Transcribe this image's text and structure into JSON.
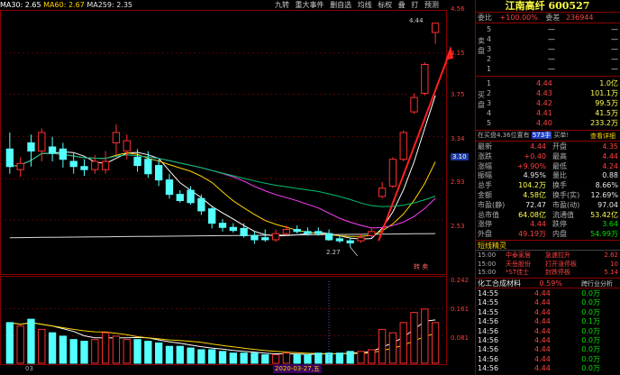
{
  "indicators": {
    "ma30": "MA30: 2.65",
    "ma60": "MA60: 2.67",
    "ma259": "MA259: 2.35"
  },
  "toolbar": [
    "九转",
    "重大事件",
    "删自选",
    "均线",
    "标权",
    "叠",
    "打",
    "预测"
  ],
  "price_scale": [
    "4.56",
    "4.15",
    "3.75",
    "3.34",
    "3.10",
    "2.93",
    "2.53"
  ],
  "vol_scale": [
    "0.242",
    "0.161",
    "0.081"
  ],
  "annotations": {
    "high_label": "4.44",
    "low_label": "2.27",
    "buy_sell": "转 卖",
    "date_axis": "2020-03-27,五",
    "date_left": "03"
  },
  "stock": {
    "name": "江南高纤",
    "code": "600527"
  },
  "order_ratio": {
    "label1": "委比",
    "val1": "+100.00%",
    "label2": "委差",
    "val2": "236944"
  },
  "sell_orders": [
    {
      "label": "5",
      "price": "—",
      "vol": "—"
    },
    {
      "label": "4",
      "price": "—",
      "vol": "—"
    },
    {
      "label": "3",
      "price": "—",
      "vol": "—"
    },
    {
      "label": "2",
      "price": "—",
      "vol": "—"
    },
    {
      "label": "1",
      "price": "—",
      "vol": "—"
    }
  ],
  "buy_orders": [
    {
      "label": "1",
      "price": "4.44",
      "vol": "1.0亿"
    },
    {
      "label": "2",
      "price": "4.43",
      "vol": "101.1万"
    },
    {
      "label": "3",
      "price": "4.42",
      "vol": "99.5万"
    },
    {
      "label": "4",
      "price": "4.41",
      "vol": "41.5万"
    },
    {
      "label": "5",
      "price": "4.40",
      "vol": "233.2万"
    }
  ],
  "side_labels": {
    "sell": "卖盘",
    "buy": "买盘"
  },
  "queue_bar": {
    "left": "在买盘4.36位置有",
    "mid": "573手",
    "right": "买单!",
    "link": "查看详细"
  },
  "quote": [
    {
      "k1": "最新",
      "v1": "4.44",
      "k2": "开盘",
      "v2": "4.35"
    },
    {
      "k1": "涨跌",
      "v1": "+0.40",
      "k2": "最高",
      "v2": "4.44"
    },
    {
      "k1": "涨幅",
      "v1": "+9.90%",
      "k2": "最低",
      "v2": "4.24"
    },
    {
      "k1": "振幅",
      "v1": "4.95%",
      "k2": "量比",
      "v2": "0.88"
    },
    {
      "k1": "总手",
      "v1": "104.2万",
      "k2": "换手",
      "v2": "8.66%"
    },
    {
      "k1": "金额",
      "v1": "4.58亿",
      "k2": "换手(实)",
      "v2": "12.69%"
    },
    {
      "k1": "市盈(静)",
      "v1": "72.47",
      "k2": "市盈(动)",
      "v2": "97.04"
    },
    {
      "k1": "总市值",
      "v1": "64.08亿",
      "k2": "流通值",
      "v2": "53.42亿"
    },
    {
      "k1": "涨停",
      "v1": "4.44",
      "k2": "跌停",
      "v2": "3.64"
    },
    {
      "k1": "外盘",
      "v1": "49.19万",
      "k2": "内盘",
      "v2": "54.99万"
    }
  ],
  "alerts": {
    "title": "短线精灵",
    "rows": [
      {
        "time": "15:00",
        "name": "中泰家居",
        "event": "急速拉升",
        "val": "2.62"
      },
      {
        "time": "15:00",
        "name": "天岳股份",
        "event": "打开涨停板",
        "val": "10"
      },
      {
        "time": "15:00",
        "name": "*ST佳士",
        "event": "封跌停板",
        "val": "5.14"
      }
    ]
  },
  "sector": {
    "name": "化工合成材料",
    "pct": "0.59%",
    "link": "跨行业分析"
  },
  "ticks": [
    {
      "time": "14:55",
      "price": "4.44",
      "vol": "0.0万"
    },
    {
      "time": "14:55",
      "price": "4.44",
      "vol": "0.0万"
    },
    {
      "time": "14:55",
      "price": "4.44",
      "vol": "0.0万"
    },
    {
      "time": "14:56",
      "price": "4.44",
      "vol": "0.1万"
    },
    {
      "time": "14:56",
      "price": "4.44",
      "vol": "0.0万"
    },
    {
      "time": "14:56",
      "price": "4.44",
      "vol": "0.0万"
    },
    {
      "time": "14:56",
      "price": "4.44",
      "vol": "0.0万"
    },
    {
      "time": "14:56",
      "price": "4.44",
      "vol": "0.0万"
    },
    {
      "time": "14:56",
      "price": "4.44",
      "vol": "0.0万"
    }
  ],
  "colors": {
    "up": "#ff3030",
    "down": "#54ffff",
    "ma_white": "#ffffff",
    "ma_yellow": "#ffd200",
    "ma_magenta": "#ff40ff",
    "ma_green": "#00c070"
  },
  "chart_data": {
    "type": "candlestick",
    "ylim": [
      2.13,
      4.56
    ],
    "candles": [
      {
        "o": 3.22,
        "c": 3.05,
        "h": 3.38,
        "l": 2.98
      },
      {
        "o": 3.02,
        "c": 3.08,
        "h": 3.14,
        "l": 2.95
      },
      {
        "o": 3.28,
        "c": 3.2,
        "h": 3.36,
        "l": 3.05
      },
      {
        "o": 3.2,
        "c": 3.38,
        "h": 3.42,
        "l": 3.1
      },
      {
        "o": 3.24,
        "c": 3.18,
        "h": 3.34,
        "l": 3.1
      },
      {
        "o": 3.22,
        "c": 3.12,
        "h": 3.28,
        "l": 3.04
      },
      {
        "o": 3.1,
        "c": 3.05,
        "h": 3.18,
        "l": 2.98
      },
      {
        "o": 3.05,
        "c": 3.02,
        "h": 3.12,
        "l": 2.96
      },
      {
        "o": 3.02,
        "c": 3.1,
        "h": 3.16,
        "l": 2.98
      },
      {
        "o": 3.02,
        "c": 3.1,
        "h": 3.2,
        "l": 2.98
      },
      {
        "o": 3.28,
        "c": 3.38,
        "h": 3.46,
        "l": 3.16
      },
      {
        "o": 3.2,
        "c": 3.3,
        "h": 3.36,
        "l": 3.12
      },
      {
        "o": 3.14,
        "c": 3.06,
        "h": 3.22,
        "l": 3.0
      },
      {
        "o": 3.12,
        "c": 2.98,
        "h": 3.2,
        "l": 2.94
      },
      {
        "o": 3.06,
        "c": 2.92,
        "h": 3.12,
        "l": 2.86
      },
      {
        "o": 2.92,
        "c": 2.78,
        "h": 2.98,
        "l": 2.74
      },
      {
        "o": 2.78,
        "c": 2.72,
        "h": 2.82,
        "l": 2.7
      },
      {
        "o": 2.82,
        "c": 2.7,
        "h": 2.86,
        "l": 2.68
      },
      {
        "o": 2.74,
        "c": 2.62,
        "h": 2.78,
        "l": 2.58
      },
      {
        "o": 2.64,
        "c": 2.5,
        "h": 2.66,
        "l": 2.45
      },
      {
        "o": 2.5,
        "c": 2.46,
        "h": 2.54,
        "l": 2.42
      },
      {
        "o": 2.46,
        "c": 2.43,
        "h": 2.5,
        "l": 2.41
      },
      {
        "o": 2.45,
        "c": 2.38,
        "h": 2.5,
        "l": 2.36
      },
      {
        "o": 2.38,
        "c": 2.34,
        "h": 2.42,
        "l": 2.3
      },
      {
        "o": 2.36,
        "c": 2.34,
        "h": 2.44,
        "l": 2.32
      },
      {
        "o": 2.34,
        "c": 2.4,
        "h": 2.44,
        "l": 2.32
      },
      {
        "o": 2.4,
        "c": 2.44,
        "h": 2.48,
        "l": 2.38
      },
      {
        "o": 2.44,
        "c": 2.42,
        "h": 2.48,
        "l": 2.4
      },
      {
        "o": 2.42,
        "c": 2.4,
        "h": 2.46,
        "l": 2.38
      },
      {
        "o": 2.42,
        "c": 2.4,
        "h": 2.46,
        "l": 2.38
      },
      {
        "o": 2.4,
        "c": 2.34,
        "h": 2.44,
        "l": 2.33
      },
      {
        "o": 2.35,
        "c": 2.33,
        "h": 2.38,
        "l": 2.31
      },
      {
        "o": 2.33,
        "c": 2.31,
        "h": 2.36,
        "l": 2.27
      },
      {
        "o": 2.33,
        "c": 2.36,
        "h": 2.4,
        "l": 2.31
      },
      {
        "o": 2.38,
        "c": 2.42,
        "h": 2.46,
        "l": 2.36
      },
      {
        "o": 2.76,
        "c": 2.84,
        "h": 2.9,
        "l": 2.74
      },
      {
        "o": 2.86,
        "c": 3.12,
        "h": 3.14,
        "l": 2.84
      },
      {
        "o": 3.12,
        "c": 3.38,
        "h": 3.4,
        "l": 3.1
      },
      {
        "o": 3.58,
        "c": 3.72,
        "h": 3.76,
        "l": 3.56
      },
      {
        "o": 3.76,
        "c": 4.04,
        "h": 4.06,
        "l": 3.74
      },
      {
        "o": 4.35,
        "c": 4.44,
        "h": 4.44,
        "l": 4.24
      }
    ],
    "volume_ylim": [
      0,
      0.242
    ],
    "volumes": [
      0.12,
      0.11,
      0.13,
      0.1,
      0.09,
      0.08,
      0.07,
      0.065,
      0.07,
      0.09,
      0.08,
      0.07,
      0.07,
      0.065,
      0.06,
      0.05,
      0.05,
      0.045,
      0.04,
      0.04,
      0.035,
      0.03,
      0.03,
      0.03,
      0.025,
      0.025,
      0.03,
      0.025,
      0.025,
      0.03,
      0.03,
      0.03,
      0.035,
      0.035,
      0.04,
      0.1,
      0.09,
      0.12,
      0.15,
      0.16,
      0.12
    ]
  }
}
